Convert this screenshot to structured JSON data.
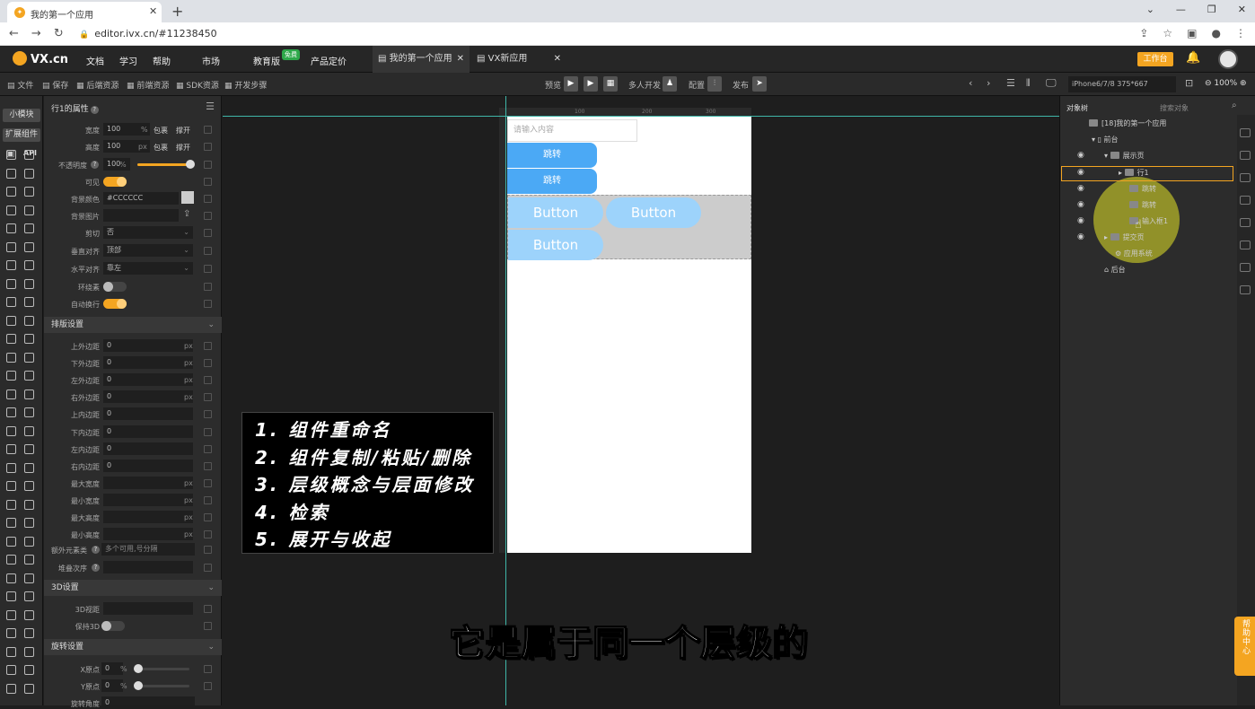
{
  "browser": {
    "tab_title": "我的第一个应用",
    "url": "editor.ivx.cn/#11238450"
  },
  "header": {
    "logo": "VX.cn",
    "menu": [
      "文档",
      "学习",
      "帮助",
      "市场",
      "教育版",
      "产品定价"
    ],
    "edu_badge": "免费",
    "tabs": [
      {
        "label": "我的第一个应用"
      },
      {
        "label": "VX新应用"
      }
    ],
    "workbench": "工作台"
  },
  "toolbar": {
    "left": [
      "文件",
      "保存",
      "后端资源",
      "前端资源",
      "SDK资源",
      "开发步骤"
    ],
    "preview": "预览",
    "multi": "多人开发",
    "config": "配置",
    "publish": "发布",
    "device": "iPhone6/7/8 375*667",
    "zoom": "100%"
  },
  "rail": {
    "tab1": "小模块",
    "tab2": "扩展组件",
    "api": "API"
  },
  "props": {
    "title": "行1的属性",
    "rows": {
      "width": {
        "label": "宽度",
        "value": "100",
        "unit": "%",
        "a": "包裹",
        "b": "撑开"
      },
      "height": {
        "label": "高度",
        "value": "100",
        "unit": "px",
        "a": "包裹",
        "b": "撑开"
      },
      "opacity": {
        "label": "不透明度",
        "value": "100",
        "unit": "%"
      },
      "visible": {
        "label": "可见"
      },
      "bgcolor": {
        "label": "背景颜色",
        "value": "#CCCCCC"
      },
      "bgimage": {
        "label": "背景图片"
      },
      "clip": {
        "label": "剪切",
        "value": "否"
      },
      "valign": {
        "label": "垂直对齐",
        "value": "顶部"
      },
      "halign": {
        "label": "水平对齐",
        "value": "靠左"
      },
      "wrap": {
        "label": "环绕素"
      },
      "autowrap": {
        "label": "自动换行"
      }
    },
    "layout_section": "排版设置",
    "layout": [
      {
        "label": "上外边距",
        "value": "0",
        "unit": "px"
      },
      {
        "label": "下外边距",
        "value": "0",
        "unit": "px"
      },
      {
        "label": "左外边距",
        "value": "0",
        "unit": "px"
      },
      {
        "label": "右外边距",
        "value": "0",
        "unit": "px"
      },
      {
        "label": "上内边距",
        "value": "0",
        "unit": ""
      },
      {
        "label": "下内边距",
        "value": "0",
        "unit": ""
      },
      {
        "label": "左内边距",
        "value": "0",
        "unit": ""
      },
      {
        "label": "右内边距",
        "value": "0",
        "unit": ""
      },
      {
        "label": "最大宽度",
        "value": "",
        "unit": "px"
      },
      {
        "label": "最小宽度",
        "value": "",
        "unit": "px"
      },
      {
        "label": "最大高度",
        "value": "",
        "unit": "px"
      },
      {
        "label": "最小高度",
        "value": "",
        "unit": "px"
      }
    ],
    "extra_class": {
      "label": "额外元素类",
      "placeholder": "多个可用,号分隔"
    },
    "stack_order": {
      "label": "堆叠次序"
    },
    "section3d": "3D设置",
    "view3d": {
      "label": "3D视距"
    },
    "keep3d": {
      "label": "保持3D"
    },
    "rotate_section": "旋转设置",
    "xorigin": {
      "label": "X原点",
      "value": "0",
      "unit": "%"
    },
    "yorigin": {
      "label": "Y原点",
      "value": "0",
      "unit": "%"
    },
    "rotate": {
      "label": "旋转角度",
      "value": "0"
    }
  },
  "canvas": {
    "input_placeholder": "请输入内容",
    "jump1": "跳转",
    "jump2": "跳转",
    "buttons": [
      "Button",
      "Button",
      "Button"
    ],
    "ruler": [
      "100",
      "200",
      "300"
    ]
  },
  "notes": [
    "1. 组件重命名",
    "2. 组件复制/粘贴/删除",
    "3. 层级概念与层面修改",
    "4. 检索",
    "5. 展开与收起"
  ],
  "subtitle": "它是属于同一个层级的",
  "tree": {
    "title": "对象树",
    "search": "搜索对象",
    "nodes": [
      "[18]我的第一个应用",
      "前台",
      "展示页",
      "行1",
      "跳转",
      "跳转",
      "输入框1",
      "提交页",
      "应用系统",
      "后台"
    ]
  },
  "help": "帮助中心"
}
